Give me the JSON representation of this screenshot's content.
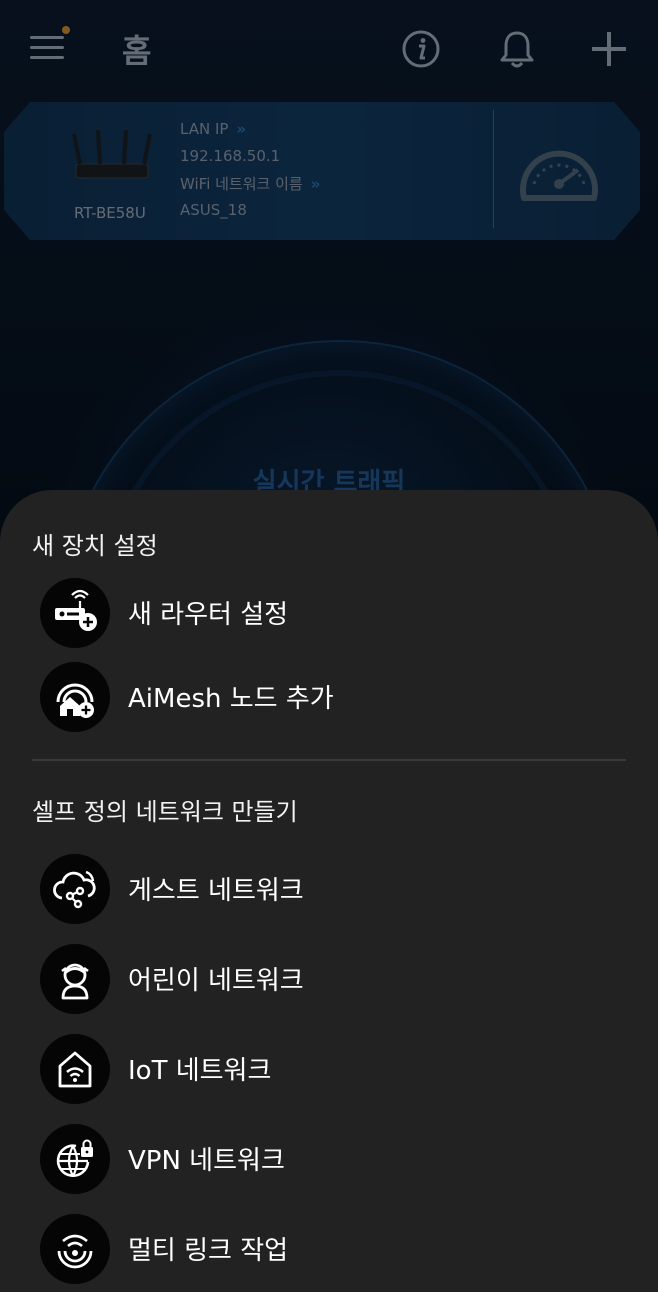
{
  "header": {
    "title": "홈",
    "menu_icon": "hamburger-menu-icon",
    "info_icon": "info-icon",
    "bell_icon": "bell-icon",
    "add_icon": "plus-icon"
  },
  "router_card": {
    "model": "RT-BE58U",
    "lan_ip_label": "LAN IP",
    "lan_ip_chevron": "»",
    "lan_ip": "192.168.50.1",
    "wifi_label": "WiFi 네트워크 이름",
    "wifi_chevron": "»",
    "wifi_name": "ASUS_18",
    "speed_icon": "speedometer-icon"
  },
  "traffic": {
    "title": "실시간 트래픽"
  },
  "sheet": {
    "section1_title": "새 장치 설정",
    "section1_items": [
      {
        "label": "새 라우터 설정",
        "icon": "router-add-icon"
      },
      {
        "label": "AiMesh 노드 추가",
        "icon": "aimesh-add-icon"
      }
    ],
    "section2_title": "셀프 정의 네트워크 만들기",
    "section2_items": [
      {
        "label": "게스트 네트워크",
        "icon": "guest-network-icon"
      },
      {
        "label": "어린이 네트워크",
        "icon": "kids-network-icon"
      },
      {
        "label": "IoT 네트워크",
        "icon": "iot-network-icon"
      },
      {
        "label": "VPN 네트워크",
        "icon": "vpn-network-icon"
      },
      {
        "label": "멀티 링크 작업",
        "icon": "multi-link-icon"
      }
    ]
  },
  "colors": {
    "sheet_bg": "#222222",
    "icon_circle": "#050505",
    "card_bg": "#123a5f",
    "accent_blue": "#2f6da6"
  }
}
